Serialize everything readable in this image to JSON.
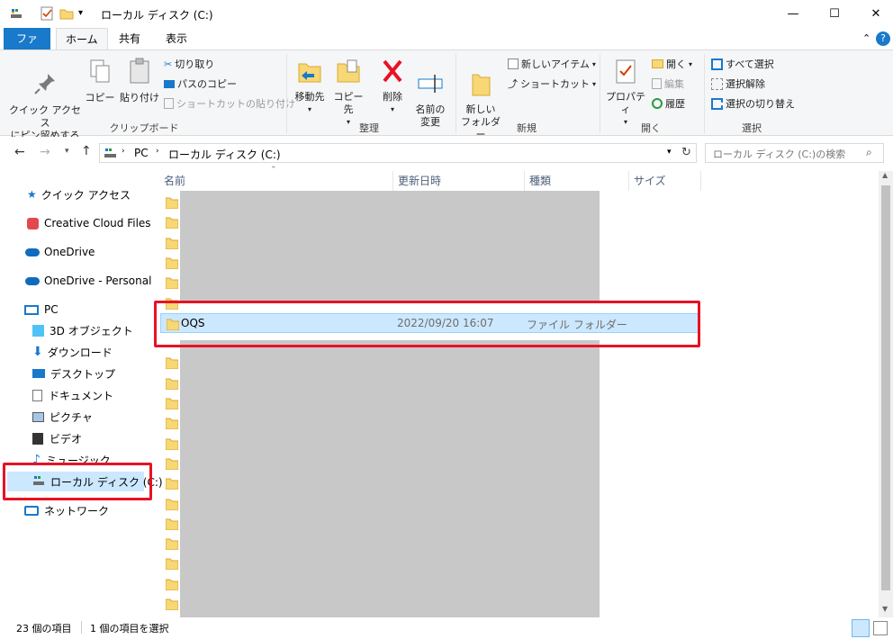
{
  "window": {
    "title": "ローカル ディスク (C:)",
    "minimize": "—",
    "maximize": "☐",
    "close": "✕"
  },
  "tabs": {
    "file": "ファイル",
    "home": "ホーム",
    "share": "共有",
    "view": "表示"
  },
  "ribbon": {
    "pin_quick": "クイック アクセス\nにピン留めする",
    "copy": "コピー",
    "paste": "貼り付け",
    "cut": "切り取り",
    "copy_path": "パスのコピー",
    "paste_shortcut": "ショートカットの貼り付け",
    "group_clipboard": "クリップボード",
    "move_to": "移動先",
    "copy_to": "コピー先",
    "delete": "削除",
    "rename": "名前の\n変更",
    "group_organize": "整理",
    "new_folder": "新しい\nフォルダー",
    "new_item": "新しいアイテム",
    "shortcut": "ショートカット",
    "group_new": "新規",
    "properties": "プロパティ",
    "open": "開く",
    "edit": "編集",
    "history": "履歴",
    "group_open": "開く",
    "select_all": "すべて選択",
    "select_none": "選択解除",
    "invert_select": "選択の切り替え",
    "group_select": "選択"
  },
  "nav": {
    "path_pc": "PC",
    "path_drive": "ローカル ディスク (C:)",
    "search_placeholder": "ローカル ディスク (C:)の検索"
  },
  "sidebar": {
    "items": [
      {
        "label": "クイック アクセス"
      },
      {
        "label": "Creative Cloud Files"
      },
      {
        "label": "OneDrive"
      },
      {
        "label": "OneDrive - Personal"
      },
      {
        "label": "PC"
      },
      {
        "label": "3D オブジェクト"
      },
      {
        "label": "ダウンロード"
      },
      {
        "label": "デスクトップ"
      },
      {
        "label": "ドキュメント"
      },
      {
        "label": "ピクチャ"
      },
      {
        "label": "ビデオ"
      },
      {
        "label": "ミュージック"
      },
      {
        "label": "ローカル ディスク (C:)"
      },
      {
        "label": "ネットワーク"
      }
    ]
  },
  "columns": {
    "name": "名前",
    "modified": "更新日時",
    "type": "種類",
    "size": "サイズ"
  },
  "selected_row": {
    "name": "OQS",
    "modified": "2022/09/20 16:07",
    "type": "ファイル フォルダー"
  },
  "status": {
    "count": "23 個の項目",
    "selected": "1 個の項目を選択"
  },
  "colors": {
    "accent": "#1979ca",
    "selection": "#cce8ff",
    "highlight": "#e81224",
    "folder": "#f8d775"
  }
}
